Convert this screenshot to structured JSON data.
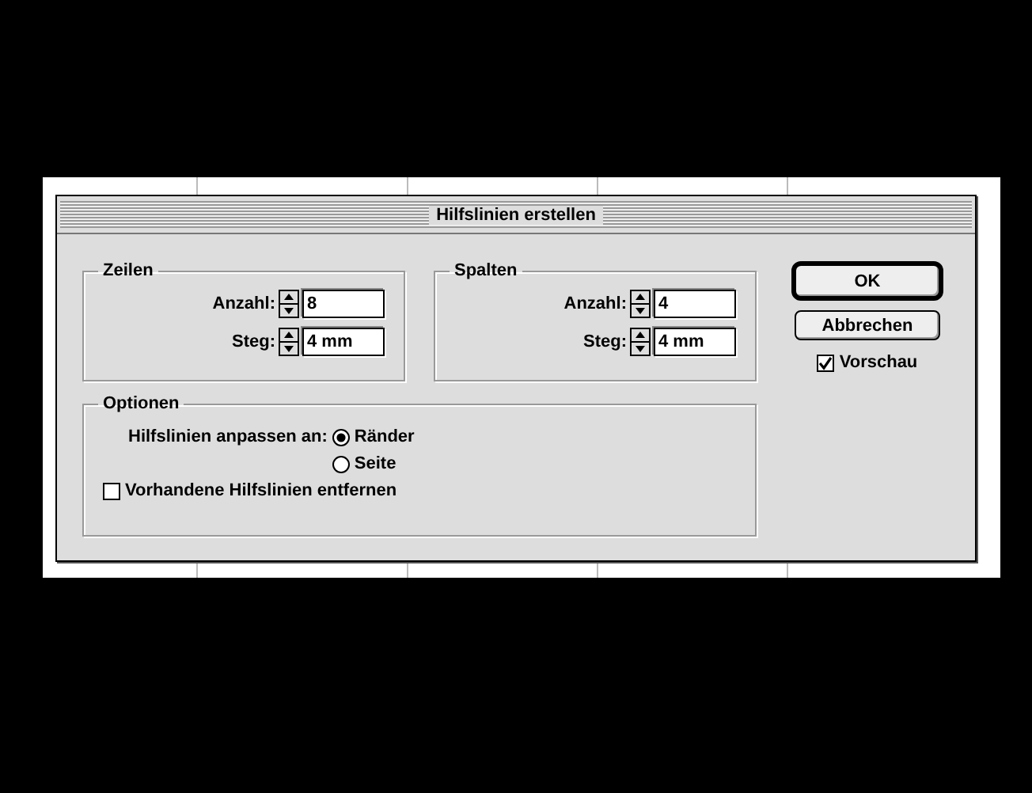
{
  "window": {
    "title": "Hilfslinien erstellen"
  },
  "groups": [
    {
      "title": "Zeilen",
      "fields": [
        {
          "label": "Anzahl:",
          "value": "8"
        },
        {
          "label": "Steg:",
          "value": "4 mm"
        }
      ]
    },
    {
      "title": "Spalten",
      "fields": [
        {
          "label": "Anzahl:",
          "value": "4"
        },
        {
          "label": "Steg:",
          "value": "4 mm"
        }
      ]
    }
  ],
  "buttons": [
    {
      "label": "OK",
      "default": true
    },
    {
      "label": "Abbrechen",
      "default": false
    }
  ],
  "preview": {
    "label": "Vorschau",
    "checked": true
  },
  "options": {
    "title": "Optionen",
    "align_label": "Hilfslinien anpassen an:",
    "radios": [
      {
        "label": "Ränder",
        "selected": true
      },
      {
        "label": "Seite",
        "selected": false
      }
    ],
    "remove_existing": {
      "label": "Vorhandene Hilfslinien entfernen",
      "checked": false
    }
  }
}
